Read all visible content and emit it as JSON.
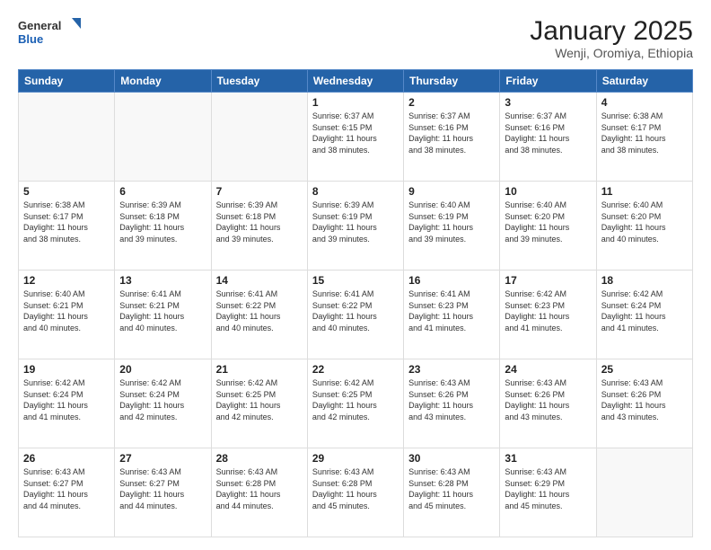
{
  "logo": {
    "line1": "General",
    "line2": "Blue"
  },
  "title": "January 2025",
  "subtitle": "Wenji, Oromiya, Ethiopia",
  "weekdays": [
    "Sunday",
    "Monday",
    "Tuesday",
    "Wednesday",
    "Thursday",
    "Friday",
    "Saturday"
  ],
  "weeks": [
    [
      {
        "day": "",
        "info": ""
      },
      {
        "day": "",
        "info": ""
      },
      {
        "day": "",
        "info": ""
      },
      {
        "day": "1",
        "info": "Sunrise: 6:37 AM\nSunset: 6:15 PM\nDaylight: 11 hours\nand 38 minutes."
      },
      {
        "day": "2",
        "info": "Sunrise: 6:37 AM\nSunset: 6:16 PM\nDaylight: 11 hours\nand 38 minutes."
      },
      {
        "day": "3",
        "info": "Sunrise: 6:37 AM\nSunset: 6:16 PM\nDaylight: 11 hours\nand 38 minutes."
      },
      {
        "day": "4",
        "info": "Sunrise: 6:38 AM\nSunset: 6:17 PM\nDaylight: 11 hours\nand 38 minutes."
      }
    ],
    [
      {
        "day": "5",
        "info": "Sunrise: 6:38 AM\nSunset: 6:17 PM\nDaylight: 11 hours\nand 38 minutes."
      },
      {
        "day": "6",
        "info": "Sunrise: 6:39 AM\nSunset: 6:18 PM\nDaylight: 11 hours\nand 39 minutes."
      },
      {
        "day": "7",
        "info": "Sunrise: 6:39 AM\nSunset: 6:18 PM\nDaylight: 11 hours\nand 39 minutes."
      },
      {
        "day": "8",
        "info": "Sunrise: 6:39 AM\nSunset: 6:19 PM\nDaylight: 11 hours\nand 39 minutes."
      },
      {
        "day": "9",
        "info": "Sunrise: 6:40 AM\nSunset: 6:19 PM\nDaylight: 11 hours\nand 39 minutes."
      },
      {
        "day": "10",
        "info": "Sunrise: 6:40 AM\nSunset: 6:20 PM\nDaylight: 11 hours\nand 39 minutes."
      },
      {
        "day": "11",
        "info": "Sunrise: 6:40 AM\nSunset: 6:20 PM\nDaylight: 11 hours\nand 40 minutes."
      }
    ],
    [
      {
        "day": "12",
        "info": "Sunrise: 6:40 AM\nSunset: 6:21 PM\nDaylight: 11 hours\nand 40 minutes."
      },
      {
        "day": "13",
        "info": "Sunrise: 6:41 AM\nSunset: 6:21 PM\nDaylight: 11 hours\nand 40 minutes."
      },
      {
        "day": "14",
        "info": "Sunrise: 6:41 AM\nSunset: 6:22 PM\nDaylight: 11 hours\nand 40 minutes."
      },
      {
        "day": "15",
        "info": "Sunrise: 6:41 AM\nSunset: 6:22 PM\nDaylight: 11 hours\nand 40 minutes."
      },
      {
        "day": "16",
        "info": "Sunrise: 6:41 AM\nSunset: 6:23 PM\nDaylight: 11 hours\nand 41 minutes."
      },
      {
        "day": "17",
        "info": "Sunrise: 6:42 AM\nSunset: 6:23 PM\nDaylight: 11 hours\nand 41 minutes."
      },
      {
        "day": "18",
        "info": "Sunrise: 6:42 AM\nSunset: 6:24 PM\nDaylight: 11 hours\nand 41 minutes."
      }
    ],
    [
      {
        "day": "19",
        "info": "Sunrise: 6:42 AM\nSunset: 6:24 PM\nDaylight: 11 hours\nand 41 minutes."
      },
      {
        "day": "20",
        "info": "Sunrise: 6:42 AM\nSunset: 6:24 PM\nDaylight: 11 hours\nand 42 minutes."
      },
      {
        "day": "21",
        "info": "Sunrise: 6:42 AM\nSunset: 6:25 PM\nDaylight: 11 hours\nand 42 minutes."
      },
      {
        "day": "22",
        "info": "Sunrise: 6:42 AM\nSunset: 6:25 PM\nDaylight: 11 hours\nand 42 minutes."
      },
      {
        "day": "23",
        "info": "Sunrise: 6:43 AM\nSunset: 6:26 PM\nDaylight: 11 hours\nand 43 minutes."
      },
      {
        "day": "24",
        "info": "Sunrise: 6:43 AM\nSunset: 6:26 PM\nDaylight: 11 hours\nand 43 minutes."
      },
      {
        "day": "25",
        "info": "Sunrise: 6:43 AM\nSunset: 6:26 PM\nDaylight: 11 hours\nand 43 minutes."
      }
    ],
    [
      {
        "day": "26",
        "info": "Sunrise: 6:43 AM\nSunset: 6:27 PM\nDaylight: 11 hours\nand 44 minutes."
      },
      {
        "day": "27",
        "info": "Sunrise: 6:43 AM\nSunset: 6:27 PM\nDaylight: 11 hours\nand 44 minutes."
      },
      {
        "day": "28",
        "info": "Sunrise: 6:43 AM\nSunset: 6:28 PM\nDaylight: 11 hours\nand 44 minutes."
      },
      {
        "day": "29",
        "info": "Sunrise: 6:43 AM\nSunset: 6:28 PM\nDaylight: 11 hours\nand 45 minutes."
      },
      {
        "day": "30",
        "info": "Sunrise: 6:43 AM\nSunset: 6:28 PM\nDaylight: 11 hours\nand 45 minutes."
      },
      {
        "day": "31",
        "info": "Sunrise: 6:43 AM\nSunset: 6:29 PM\nDaylight: 11 hours\nand 45 minutes."
      },
      {
        "day": "",
        "info": ""
      }
    ]
  ]
}
